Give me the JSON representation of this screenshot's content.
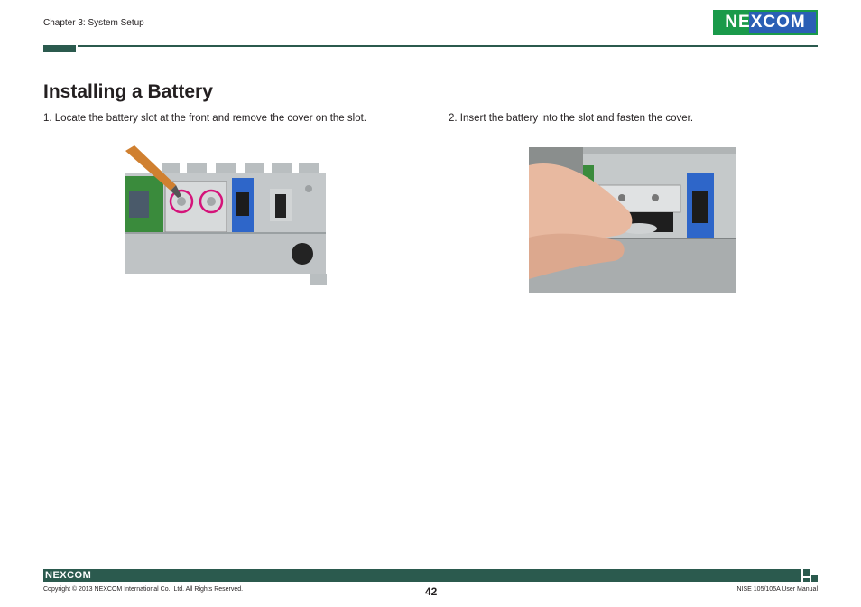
{
  "header": {
    "chapter": "Chapter 3: System Setup",
    "logo_text": "NEXCOM"
  },
  "main": {
    "title": "Installing a Battery",
    "step1": "1. Locate the battery slot at the front and remove the cover on the slot.",
    "step2": "2. Insert the battery into the slot and fasten the cover."
  },
  "footer": {
    "logo_text": "NEXCOM",
    "copyright": "Copyright © 2013 NEXCOM International Co., Ltd. All Rights Reserved.",
    "page_number": "42",
    "manual_name": "NISE 105/105A User Manual"
  },
  "colors": {
    "brand_green": "#1a9a4a",
    "brand_blue": "#2a5fb5",
    "rule_color": "#2b5a4e",
    "highlight_circle": "#d4147a"
  }
}
